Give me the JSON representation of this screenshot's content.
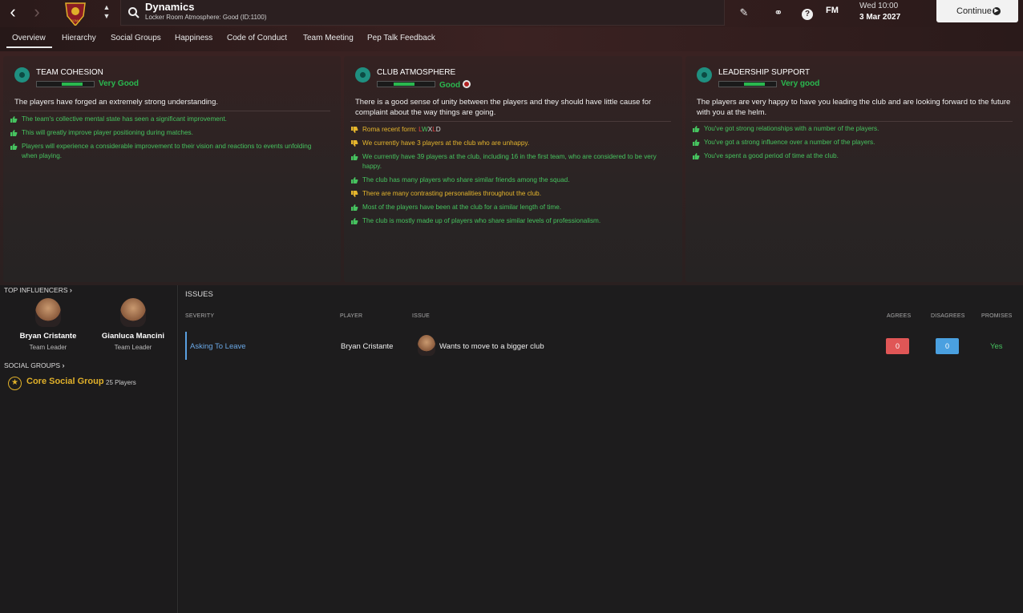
{
  "header": {
    "title": "Dynamics",
    "subtitle": "Locker Room Atmosphere: Good (ID:1100)",
    "fm_label": "FM",
    "date_line1": "Wed 10:00",
    "date_line2": "3 Mar 2027",
    "continue_label": "Continue",
    "club_badge_text": "ROMA"
  },
  "tabs": [
    {
      "label": "Overview"
    },
    {
      "label": "Hierarchy"
    },
    {
      "label": "Social Groups"
    },
    {
      "label": "Happiness"
    },
    {
      "label": "Code of Conduct"
    },
    {
      "label": "Team Meeting"
    },
    {
      "label": "Pep Talk Feedback"
    }
  ],
  "panels": {
    "cohesion": {
      "title": "TEAM COHESION",
      "rating": "Very Good",
      "level": 0.8,
      "summary": "The players have forged an extremely strong understanding.",
      "factors": [
        {
          "text": "The team's collective mental state has seen a significant improvement."
        },
        {
          "text": "This will greatly improve player positioning during matches."
        },
        {
          "text": "Players will experience a considerable improvement to their vision and reactions to events unfolding when playing."
        }
      ]
    },
    "atmosphere": {
      "title": "CLUB ATMOSPHERE",
      "rating": "Good",
      "level": 0.65,
      "summary": "There is a good sense of unity between the players and they should have little cause for complaint about the way things are going.",
      "form_label": "Roma recent form: ",
      "form": [
        "L",
        "W",
        "X",
        "L",
        "D"
      ],
      "factors": [
        {
          "text": "We currently have 3 players at the club who are unhappy."
        },
        {
          "text": "We currently have 39 players at the club, including 16 in the first team, who are considered to be very happy."
        },
        {
          "text": "The club has many players who share similar friends among the squad."
        },
        {
          "text": "There are many contrasting personalities throughout the club."
        },
        {
          "text": "Most of the players have been at the club for a similar length of time."
        },
        {
          "text": "The club is mostly made up of players who share similar levels of professionalism."
        }
      ]
    },
    "leadership": {
      "title": "LEADERSHIP SUPPORT",
      "rating": "Very good",
      "level": 0.8,
      "summary": "The players are very happy to have you leading the club and are looking forward to the future with you at the helm.",
      "factors": [
        {
          "text": "You've got strong relationships with a number of the players."
        },
        {
          "text": "You've got a strong influence over a number of the players."
        },
        {
          "text": "You've spent a good period of time at the club."
        }
      ]
    }
  },
  "influencers": {
    "heading": "TOP INFLUENCERS",
    "people": [
      {
        "name": "Bryan Cristante",
        "role": "Team Leader"
      },
      {
        "name": "Gianluca Mancini",
        "role": "Team Leader"
      }
    ]
  },
  "social_groups": {
    "heading": "SOCIAL GROUPS",
    "group_name": "Core Social Group",
    "group_count": "25 Players"
  },
  "issues": {
    "title": "ISSUES",
    "columns": {
      "severity": "SEVERITY",
      "player": "PLAYER",
      "issue": "ISSUE",
      "agrees": "AGREES",
      "disagrees": "DISAGREES",
      "promises": "PROMISES"
    },
    "rows": [
      {
        "severity": "Asking To Leave",
        "player": "Bryan Cristante",
        "issue": "Wants to move to a bigger club",
        "agrees": "0",
        "disagrees": "0",
        "promises": "Yes"
      }
    ]
  },
  "colors": {
    "positive": "#46c35f",
    "neutral": "#e6b62d",
    "accent_teal": "#1f8f80",
    "agree": "#e05656",
    "disagree": "#4aa0e0"
  }
}
